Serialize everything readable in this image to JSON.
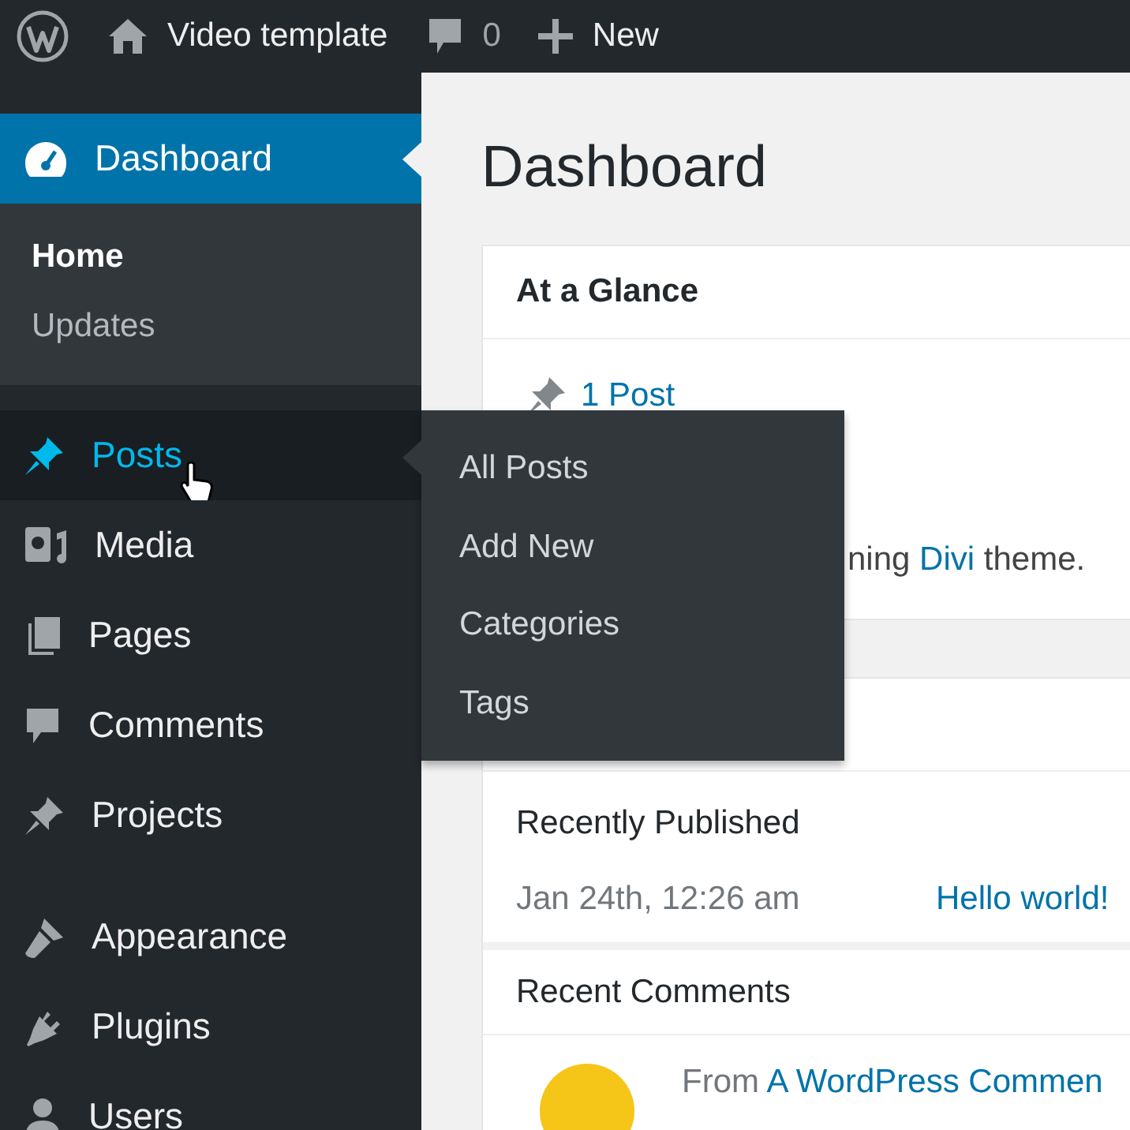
{
  "top_bar": {
    "site_name": "Video template",
    "comments_count": "0",
    "new_label": "New"
  },
  "sidebar": {
    "items": [
      {
        "label": "Dashboard",
        "selected": true,
        "hovered": false,
        "children": [
          {
            "label": "Home",
            "selected": true
          },
          {
            "label": "Updates",
            "selected": false
          }
        ]
      },
      {
        "label": "Posts",
        "selected": false,
        "hovered": true,
        "flyout": [
          "All Posts",
          "Add New",
          "Categories",
          "Tags"
        ]
      },
      {
        "label": "Media",
        "selected": false,
        "hovered": false
      },
      {
        "label": "Pages",
        "selected": false,
        "hovered": false
      },
      {
        "label": "Comments",
        "selected": false,
        "hovered": false
      },
      {
        "label": "Projects",
        "selected": false,
        "hovered": false
      },
      {
        "label": "Appearance",
        "selected": false,
        "hovered": false
      },
      {
        "label": "Plugins",
        "selected": false,
        "hovered": false
      },
      {
        "label": "Users",
        "selected": false,
        "hovered": false
      }
    ]
  },
  "page_title": "Dashboard",
  "at_a_glance": {
    "title": "At a Glance",
    "post_count": "1 Post",
    "theme_text_before": "ning",
    "theme_link": "Divi",
    "theme_text_after": "theme."
  },
  "activity": {
    "recently_published": "Recently Published",
    "post_date": "Jan 24th, 12:26 am",
    "post_link": "Hello world!",
    "recent_comments": "Recent Comments",
    "comment_from": "From",
    "comment_author": "A WordPress Commen"
  }
}
